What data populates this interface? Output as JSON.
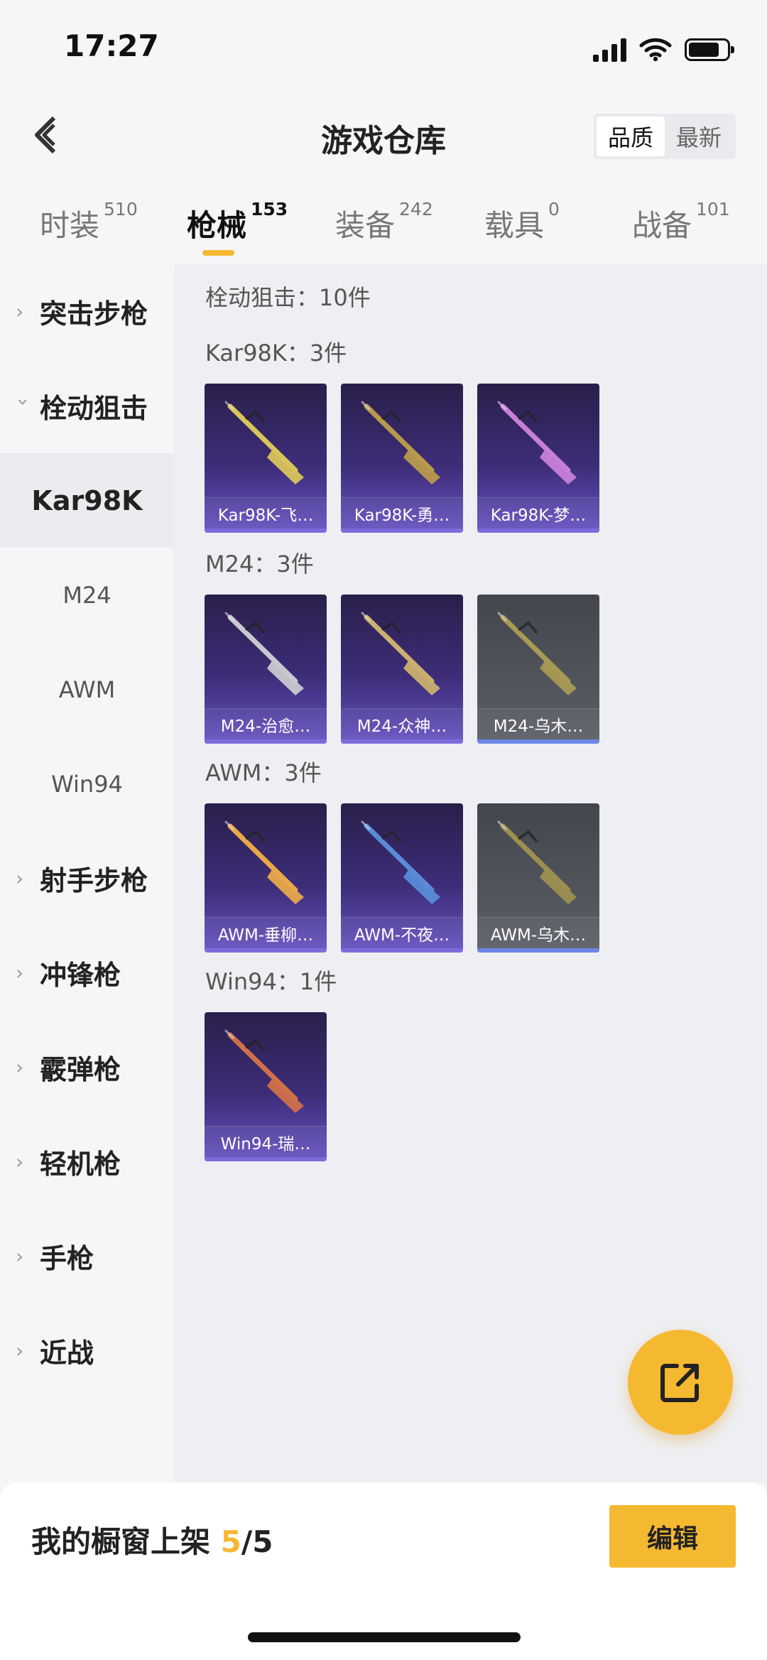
{
  "status": {
    "time": "17:27",
    "battery_level": 0.8
  },
  "header": {
    "title": "游戏仓库",
    "sort_options": [
      "品质",
      "最新"
    ],
    "sort_selected": "品质"
  },
  "tabs": [
    {
      "label": "时装",
      "count": "510"
    },
    {
      "label": "枪械",
      "count": "153"
    },
    {
      "label": "装备",
      "count": "242"
    },
    {
      "label": "载具",
      "count": "0"
    },
    {
      "label": "战备",
      "count": "101"
    }
  ],
  "active_tab": "枪械",
  "sidebar": {
    "categories": [
      {
        "label": "突击步枪",
        "expanded": false
      },
      {
        "label": "栓动狙击",
        "expanded": true,
        "children": [
          "Kar98K",
          "M24",
          "AWM",
          "Win94"
        ]
      },
      {
        "label": "射手步枪",
        "expanded": false
      },
      {
        "label": "冲锋枪",
        "expanded": false
      },
      {
        "label": "霰弹枪",
        "expanded": false
      },
      {
        "label": "轻机枪",
        "expanded": false
      },
      {
        "label": "手枪",
        "expanded": false
      },
      {
        "label": "近战",
        "expanded": false
      }
    ],
    "selected_child": "Kar98K"
  },
  "content": {
    "total": "栓动狙击：10件",
    "groups": [
      {
        "title": "Kar98K：3件",
        "items": [
          {
            "name": "Kar98K-飞…",
            "quality": "purple",
            "gun_color": "#d8c45a"
          },
          {
            "name": "Kar98K-勇…",
            "quality": "purple",
            "gun_color": "#b89a4c"
          },
          {
            "name": "Kar98K-梦…",
            "quality": "purple",
            "gun_color": "#c77fd8"
          }
        ]
      },
      {
        "title": "M24：3件",
        "items": [
          {
            "name": "M24-治愈…",
            "quality": "purple",
            "gun_color": "#c8c8d0"
          },
          {
            "name": "M24-众神…",
            "quality": "purple",
            "gun_color": "#c9b070"
          },
          {
            "name": "M24-乌木…",
            "quality": "gray",
            "gun_color": "#a89a55"
          }
        ]
      },
      {
        "title": "AWM：3件",
        "items": [
          {
            "name": "AWM-垂柳…",
            "quality": "purple",
            "gun_color": "#e8a84a"
          },
          {
            "name": "AWM-不夜…",
            "quality": "purple",
            "gun_color": "#5a8ad8"
          },
          {
            "name": "AWM-乌木…",
            "quality": "gray",
            "gun_color": "#9c9050"
          }
        ]
      },
      {
        "title": "Win94：1件",
        "items": [
          {
            "name": "Win94-瑞…",
            "quality": "purple",
            "gun_color": "#d0704a"
          }
        ]
      }
    ]
  },
  "fab": {
    "icon": "share-external-icon"
  },
  "bottom": {
    "label": "我的橱窗上架",
    "count": "5",
    "total": "/5",
    "edit_label": "编辑"
  },
  "colors": {
    "accent": "#f5b831",
    "purple_card": "#3d2d78",
    "gray_card": "#54565e"
  }
}
